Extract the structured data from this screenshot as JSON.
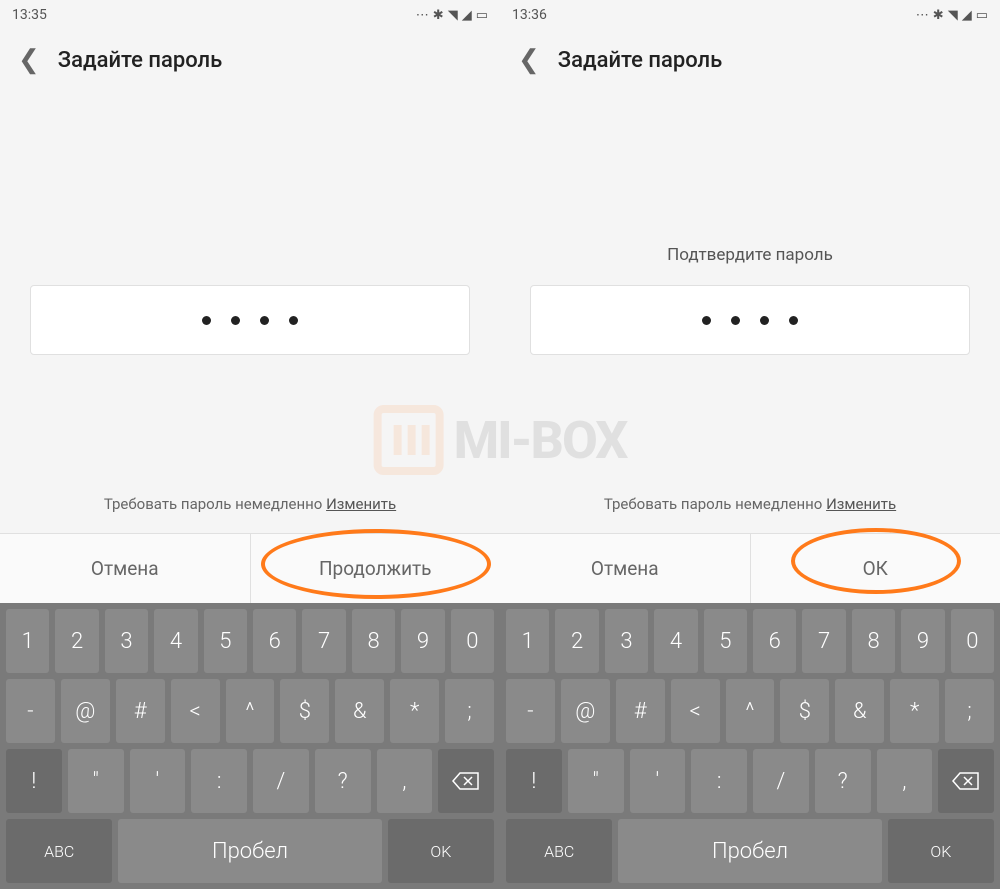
{
  "screens": [
    {
      "time": "13:35",
      "header_title": "Задайте пароль",
      "confirm_label": "",
      "require_text": "Требовать пароль немедленно ",
      "change_link": "Изменить",
      "cancel": "Отмена",
      "proceed": "Продолжить"
    },
    {
      "time": "13:36",
      "header_title": "Задайте пароль",
      "confirm_label": "Подтвердите пароль",
      "require_text": "Требовать пароль немедленно ",
      "change_link": "Изменить",
      "cancel": "Отмена",
      "proceed": "ОК"
    }
  ],
  "keyboard": {
    "row1": [
      "1",
      "2",
      "3",
      "4",
      "5",
      "6",
      "7",
      "8",
      "9",
      "0"
    ],
    "row2": [
      "-",
      "@",
      "#",
      "<",
      "^",
      "$",
      "&",
      "*",
      ";"
    ],
    "row3_first": "!",
    "row3_mid": [
      "\"",
      "'",
      ":",
      "/",
      "?",
      ","
    ],
    "abc": "ABC",
    "space": "Пробел",
    "ok": "OK"
  },
  "watermark": "MI-BOX"
}
